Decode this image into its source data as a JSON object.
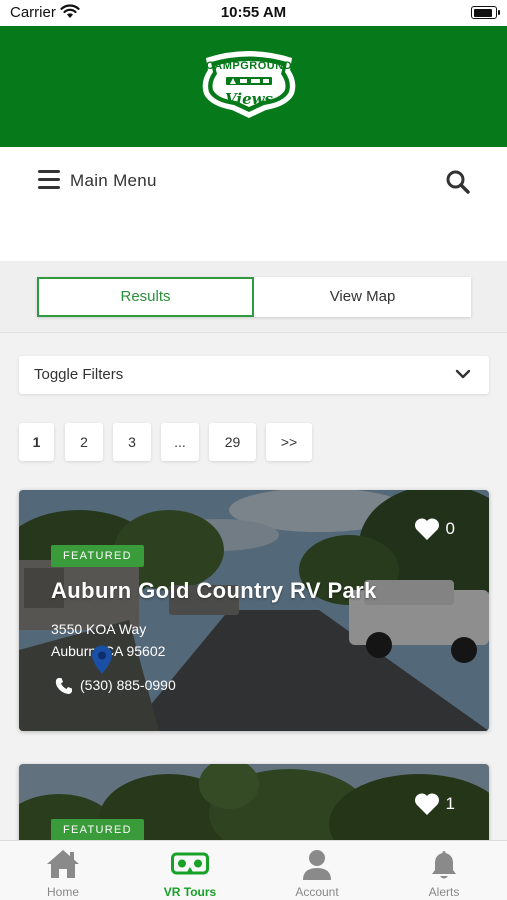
{
  "status_bar": {
    "carrier": "Carrier",
    "time": "10:55 AM",
    "battery_level": 0.9
  },
  "header": {
    "logo_top_text": "CAMPGROUND",
    "logo_bottom_text": "Views",
    "brand_color": "#067a1b"
  },
  "nav": {
    "menu_label": "Main Menu",
    "menu_icon": "hamburger-icon",
    "search_icon": "search-icon"
  },
  "view_tabs": [
    {
      "label": "Results",
      "active": true
    },
    {
      "label": "View Map",
      "active": false
    }
  ],
  "filters": {
    "label": "Toggle Filters",
    "icon": "chevron-down-icon"
  },
  "pagination": [
    "1",
    "2",
    "3",
    "...",
    "29",
    ">>"
  ],
  "cards": [
    {
      "badge": "FEATURED",
      "title": "Auburn Gold Country RV Park",
      "address_line1": "3550 KOA Way",
      "address_line2": "Auburn, CA 95602",
      "phone": "(530) 885-0990",
      "favorites": "0"
    },
    {
      "badge": "FEATURED",
      "favorites": "1"
    }
  ],
  "tab_bar": [
    {
      "label": "Home",
      "icon": "home-icon",
      "active": false
    },
    {
      "label": "VR Tours",
      "icon": "vr-headset-icon",
      "active": true
    },
    {
      "label": "Account",
      "icon": "person-icon",
      "active": false
    },
    {
      "label": "Alerts",
      "icon": "bell-icon",
      "active": false
    }
  ],
  "colors": {
    "accent_green": "#17a126",
    "badge_green": "#3a9b3a",
    "tab_border_green": "#2f9a3f"
  }
}
